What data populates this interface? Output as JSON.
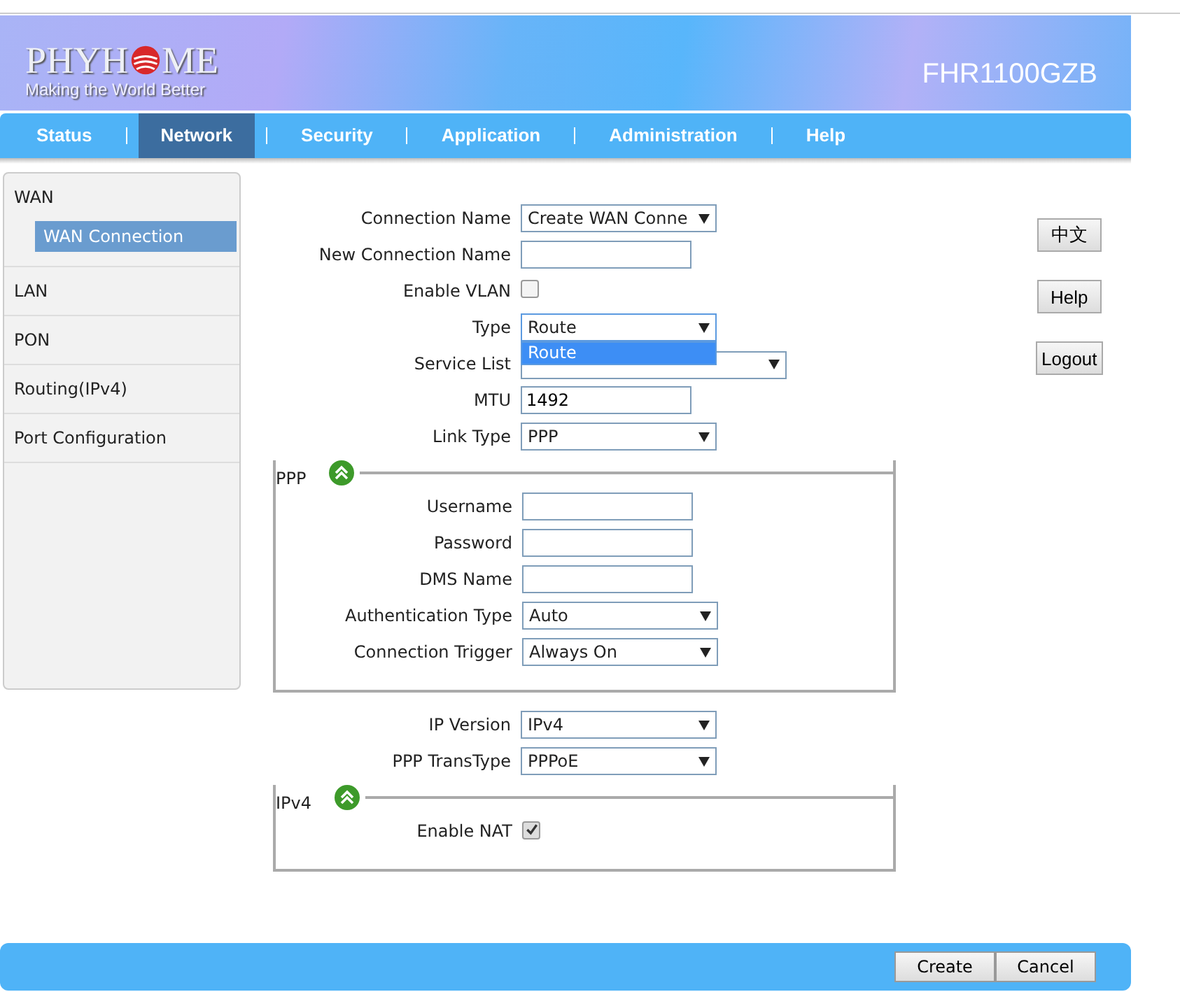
{
  "header": {
    "logo_parts": [
      "PHYH",
      "ME"
    ],
    "tagline": "Making the World Better",
    "model": "FHR1100GZB"
  },
  "nav": [
    {
      "label": "Status",
      "selected": false
    },
    {
      "label": "Network",
      "selected": true
    },
    {
      "label": "Security",
      "selected": false
    },
    {
      "label": "Application",
      "selected": false
    },
    {
      "label": "Administration",
      "selected": false
    },
    {
      "label": "Help",
      "selected": false
    }
  ],
  "sidebar": {
    "items": [
      {
        "label": "WAN",
        "children": [
          {
            "label": "WAN Connection",
            "selected": true
          }
        ]
      },
      {
        "label": "LAN"
      },
      {
        "label": "PON"
      },
      {
        "label": "Routing(IPv4)"
      },
      {
        "label": "Port Configuration"
      }
    ]
  },
  "form": {
    "rows": [
      {
        "kind": "select",
        "label": "Connection Name",
        "value": "Create WAN Conne"
      },
      {
        "kind": "text",
        "label": "New Connection Name",
        "value": ""
      },
      {
        "kind": "checkbox",
        "label": "Enable VLAN",
        "checked": false
      },
      {
        "kind": "select",
        "label": "Type",
        "value": "Route",
        "open": true,
        "options": [
          {
            "label": "Route",
            "selected": true
          }
        ]
      },
      {
        "kind": "wide-select",
        "label": "Service List",
        "value": ""
      },
      {
        "kind": "text",
        "label": "MTU",
        "value": "1492"
      },
      {
        "kind": "select",
        "label": "Link Type",
        "value": "PPP"
      }
    ],
    "ppp": {
      "legend": "PPP",
      "rows": [
        {
          "kind": "text",
          "label": "Username",
          "value": ""
        },
        {
          "kind": "text",
          "label": "Password",
          "value": ""
        },
        {
          "kind": "text",
          "label": "DMS Name",
          "value": ""
        },
        {
          "kind": "select",
          "label": "Authentication Type",
          "value": "Auto"
        },
        {
          "kind": "select",
          "label": "Connection Trigger",
          "value": "Always On"
        }
      ]
    },
    "middle_rows": [
      {
        "kind": "select",
        "label": "IP Version",
        "value": "IPv4"
      },
      {
        "kind": "select",
        "label": "PPP TransType",
        "value": "PPPoE"
      }
    ],
    "ipv4": {
      "legend": "IPv4",
      "rows": [
        {
          "kind": "checkbox",
          "label": "Enable NAT",
          "checked": true
        }
      ]
    }
  },
  "side_buttons": [
    "中文",
    "Help",
    "Logout"
  ],
  "footer_buttons": [
    "Create",
    "Cancel"
  ]
}
